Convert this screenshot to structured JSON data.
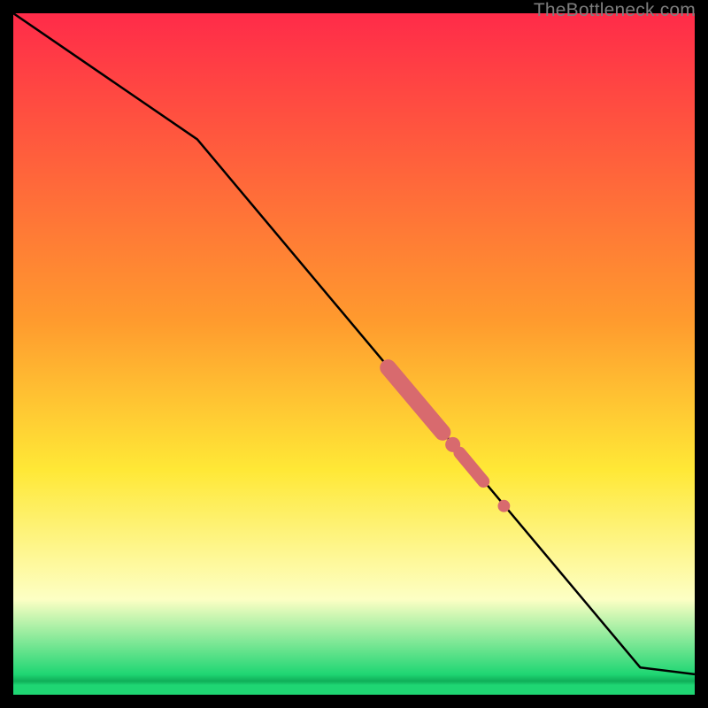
{
  "watermark": "TheBottleneck.com",
  "colors": {
    "red": "#ff2b49",
    "orange": "#ff9a2e",
    "yellow": "#ffe836",
    "pale": "#fdffc4",
    "green": "#1fd673",
    "marker": "#d86a6e",
    "line": "#000000"
  },
  "gradient_stops": [
    {
      "pct": 0.0,
      "key": "red"
    },
    {
      "pct": 45.0,
      "key": "orange"
    },
    {
      "pct": 67.0,
      "key": "yellow"
    },
    {
      "pct": 86.0,
      "key": "pale"
    },
    {
      "pct": 97.0,
      "key": "green"
    },
    {
      "pct": 98.0,
      "key": "green_line"
    },
    {
      "pct": 98.6,
      "key": "green"
    },
    {
      "pct": 100.0,
      "key": "green"
    }
  ],
  "chart_data": {
    "type": "line",
    "title": "",
    "xlabel": "",
    "ylabel": "",
    "xlim": [
      0,
      100
    ],
    "ylim": [
      0,
      100
    ],
    "note": "Axes are not labeled in the image; x/y expressed as 0-100% of the inner plot area (origin top-left, y increases downward as drawn).",
    "series": [
      {
        "name": "main-curve",
        "points": [
          {
            "x": 0.0,
            "y": 0.0
          },
          {
            "x": 27.0,
            "y": 18.5
          },
          {
            "x": 92.0,
            "y": 96.0
          },
          {
            "x": 100.0,
            "y": 97.0
          }
        ]
      }
    ],
    "markers": [
      {
        "shape": "thick-segment",
        "x1": 55.0,
        "y1": 52.0,
        "x2": 63.0,
        "y2": 61.5,
        "width": 2.4
      },
      {
        "shape": "dot",
        "x": 64.5,
        "y": 63.3,
        "r": 1.1
      },
      {
        "shape": "thick-segment",
        "x1": 65.5,
        "y1": 64.5,
        "x2": 69.0,
        "y2": 68.7,
        "width": 1.8
      },
      {
        "shape": "dot",
        "x": 72.0,
        "y": 72.3,
        "r": 0.9
      }
    ]
  }
}
